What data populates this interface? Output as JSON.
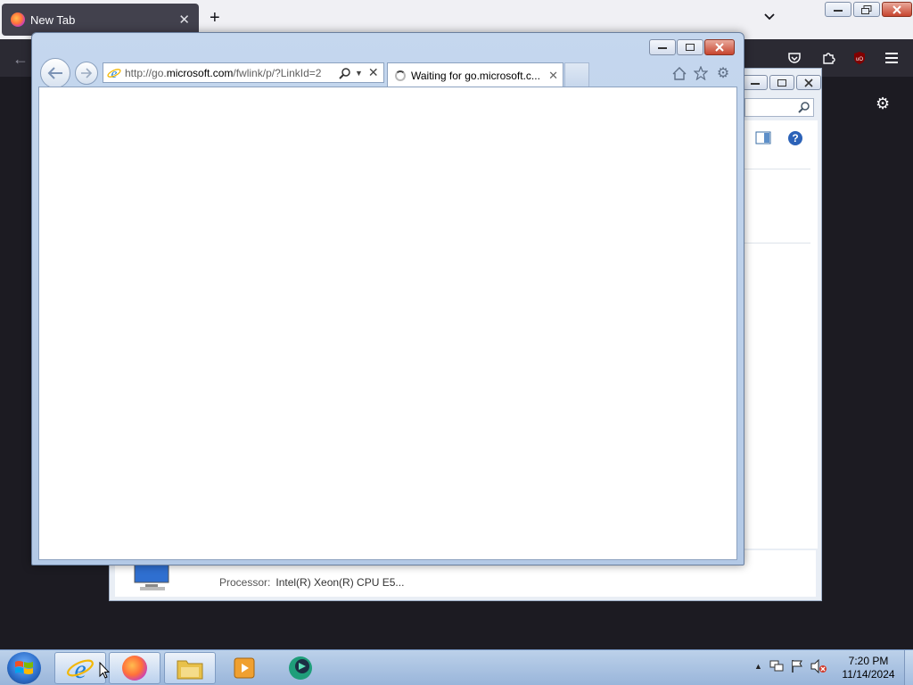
{
  "firefox": {
    "tab_label": "New Tab",
    "tab_close": "✕",
    "new_tab": "+"
  },
  "ie": {
    "address_url_gray_prefix": "http://go.",
    "address_url_domain": "microsoft.com",
    "address_url_suffix": "/fwlink/p/?LinkId=2",
    "tab_title": "Waiting for go.microsoft.c...",
    "tab_close": "✕",
    "address_stop": "✕"
  },
  "control_panel": {
    "processor_label": "Processor:",
    "processor_value": "Intel(R) Xeon(R) CPU E5..."
  },
  "taskbar": {
    "time": "7:20 PM",
    "date": "11/14/2024"
  },
  "icons": [
    "firefox-icon",
    "chevron-down-icon",
    "back-arrow-icon",
    "pocket-icon",
    "extensions-icon",
    "ublock-icon",
    "menu-icon",
    "gear-icon",
    "search-icon",
    "help-icon",
    "home-icon",
    "favorites-star-icon",
    "tools-gear-icon",
    "ie-icon",
    "windows-start-icon",
    "explorer-folder-icon",
    "media-player-icon",
    "network-icon",
    "flag-icon",
    "volume-muted-icon"
  ]
}
